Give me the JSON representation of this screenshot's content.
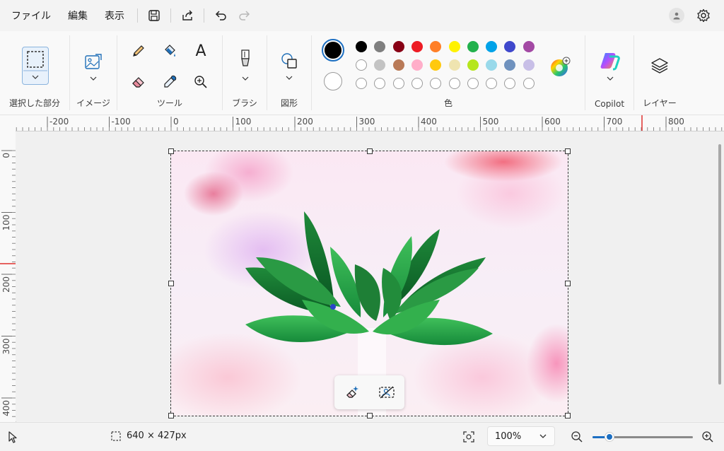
{
  "menu": {
    "file": "ファイル",
    "edit": "編集",
    "view": "表示"
  },
  "ribbon": {
    "selection_label": "選択した部分",
    "image_label": "イメージ",
    "tools_label": "ツール",
    "brush_label": "ブラシ",
    "shapes_label": "図形",
    "colors_label": "色",
    "copilot_label": "Copilot",
    "layers_label": "レイヤー",
    "text_tool_glyph": "A"
  },
  "palette": {
    "primary": "#000000",
    "secondary": "#ffffff",
    "row1": [
      "#000000",
      "#7f7f7f",
      "#880015",
      "#ed1c24",
      "#ff7f27",
      "#fff200",
      "#22b14c",
      "#00a2e8",
      "#3f48cc",
      "#a349a4"
    ],
    "row2": [
      "#ffffff",
      "#c3c3c3",
      "#b97a57",
      "#ffaec9",
      "#ffc90e",
      "#efe4b0",
      "#b5e61d",
      "#99d9ea",
      "#7092be",
      "#c8bfe7"
    ],
    "row3_empty": 10
  },
  "rulers": {
    "horizontal": [
      "-200",
      "-100",
      "0",
      "100",
      "200",
      "300",
      "400",
      "500",
      "600",
      "700",
      "800"
    ],
    "vertical": [
      "0",
      "100",
      "200",
      "300",
      "400"
    ]
  },
  "status": {
    "dimensions": "640 × 427px",
    "zoom": "100%",
    "zoom_level": 0.17
  }
}
